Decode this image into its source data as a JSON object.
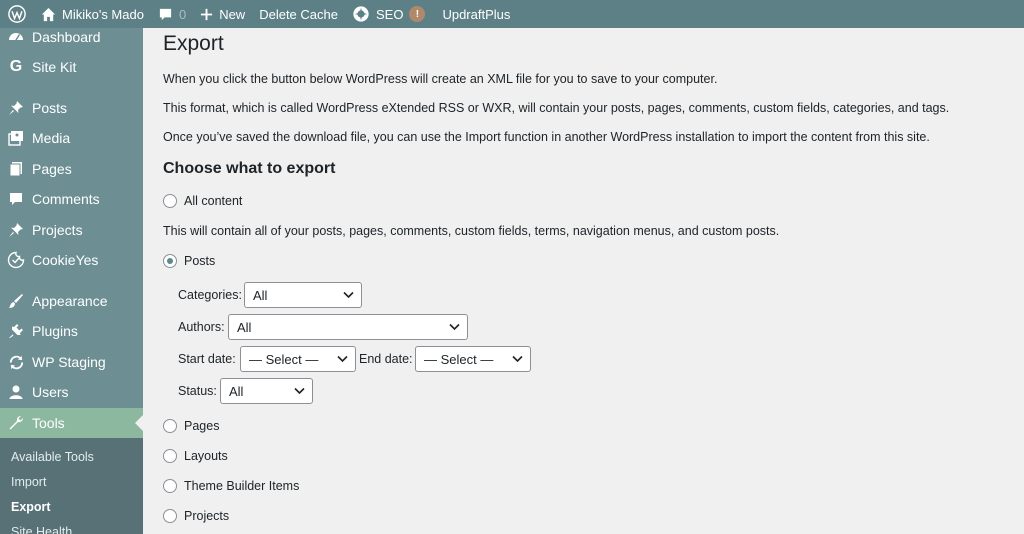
{
  "admin_bar": {
    "site_name": "Mikiko's Mado",
    "comments_count": "0",
    "new_label": "New",
    "delete_cache_label": "Delete Cache",
    "seo_label": "SEO",
    "seo_badge": "!",
    "updraft_label": "UpdraftPlus",
    "icons": [
      "wordpress-logo-icon",
      "home-icon",
      "comment-icon",
      "plus-icon",
      "seo-icon"
    ]
  },
  "sidebar": {
    "items": [
      {
        "label": "Dashboard",
        "icon": "dashboard-icon"
      },
      {
        "label": "Site Kit",
        "icon": "google-icon"
      },
      {
        "label": "Posts",
        "icon": "pin-icon"
      },
      {
        "label": "Media",
        "icon": "media-icon"
      },
      {
        "label": "Pages",
        "icon": "page-icon"
      },
      {
        "label": "Comments",
        "icon": "comment-icon"
      },
      {
        "label": "Projects",
        "icon": "pin-icon"
      },
      {
        "label": "CookieYes",
        "icon": "cookie-icon"
      },
      {
        "label": "Appearance",
        "icon": "brush-icon"
      },
      {
        "label": "Plugins",
        "icon": "plugin-icon"
      },
      {
        "label": "WP Staging",
        "icon": "sync-icon"
      },
      {
        "label": "Users",
        "icon": "user-icon"
      },
      {
        "label": "Tools",
        "icon": "wrench-icon"
      }
    ],
    "submenu": [
      "Available Tools",
      "Import",
      "Export",
      "Site Health"
    ]
  },
  "page": {
    "title": "Export",
    "para1": "When you click the button below WordPress will create an XML file for you to save to your computer.",
    "para2": "This format, which is called WordPress eXtended RSS or WXR, will contain your posts, pages, comments, custom fields, categories, and tags.",
    "para3": "Once you’ve saved the download file, you can use the Import function in another WordPress installation to import the content from this site.",
    "section_title": "Choose what to export",
    "options": {
      "all_content": "All content",
      "all_content_desc": "This will contain all of your posts, pages, comments, custom fields, terms, navigation menus, and custom posts.",
      "posts": "Posts",
      "pages": "Pages",
      "layouts": "Layouts",
      "theme_builder": "Theme Builder Items",
      "projects": "Projects"
    },
    "filters": {
      "categories_label": "Categories:",
      "categories_value": "All",
      "authors_label": "Authors:",
      "authors_value": "All",
      "start_date_label": "Start date:",
      "start_date_value": "— Select —",
      "end_date_label": "End date:",
      "end_date_value": "— Select —",
      "status_label": "Status:",
      "status_value": "All"
    }
  },
  "colors": {
    "admin_bar": "#5d8087",
    "sidebar": "#6d8f93",
    "submenu": "#577176",
    "current_item": "#8bb89e",
    "content_bg": "#f0f0f1"
  }
}
